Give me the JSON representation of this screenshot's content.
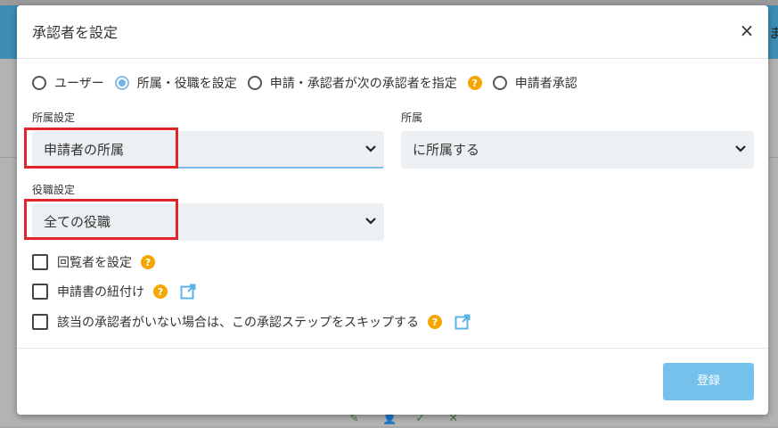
{
  "background": {
    "side_text": "ま",
    "icons": [
      "pencil-icon",
      "user-icon",
      "check-icon",
      "close-icon"
    ]
  },
  "modal": {
    "title": "承認者を設定",
    "close_label": "×"
  },
  "radio_options": [
    {
      "label": "ユーザー",
      "checked": false
    },
    {
      "label": "所属・役職を設定",
      "checked": true
    },
    {
      "label": "申請・承認者が次の承認者を指定",
      "checked": false,
      "help": "?"
    },
    {
      "label": "申請者承認",
      "checked": false
    }
  ],
  "fields": {
    "affiliation_setting": {
      "label": "所属設定",
      "value": "申請者の所属"
    },
    "affiliation": {
      "label": "所属",
      "value": "に所属する"
    },
    "position_setting": {
      "label": "役職設定",
      "value": "全ての役職"
    }
  },
  "checkboxes": [
    {
      "label": "回覧者を設定",
      "help": "?",
      "checked": false
    },
    {
      "label": "申請書の紐付け",
      "help": "?",
      "checked": false
    },
    {
      "label": "該当の承認者がいない場合は、この承認ステップをスキップする",
      "help": "?",
      "checked": false
    }
  ],
  "submit_label": "登録",
  "colors": {
    "accent": "#74c1ec",
    "help": "#f4a700",
    "highlight": "#e0252c",
    "header": "#3d8db5"
  }
}
